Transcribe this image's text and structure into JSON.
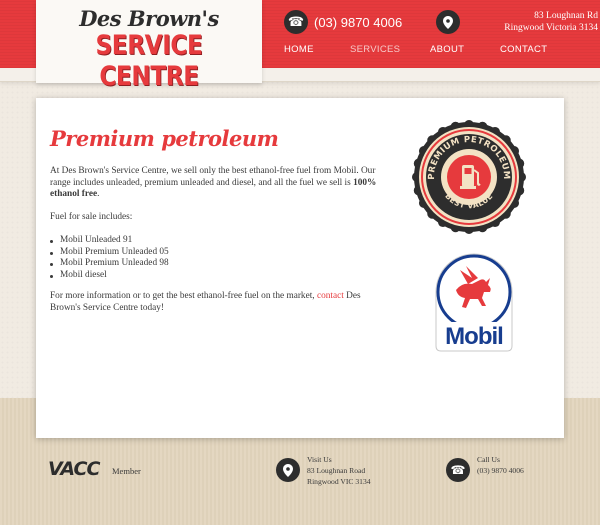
{
  "brand": {
    "script_line": "Des Brown's",
    "main_line": "SERVICE CENTRE"
  },
  "header": {
    "phone": "(03) 9870 4006",
    "address_line1": "83 Loughnan Rd",
    "address_line2": "Ringwood Victoria 3134",
    "phone_icon": "phone-icon",
    "location_icon": "location-pin-icon"
  },
  "nav": {
    "items": [
      {
        "label": "HOME",
        "active": false
      },
      {
        "label": "SERVICES",
        "active": true
      },
      {
        "label": "ABOUT",
        "active": false
      },
      {
        "label": "CONTACT",
        "active": false
      }
    ]
  },
  "main": {
    "title": "Premium petroleum",
    "intro_pre": "At Des Brown's Service Centre, we sell only the best ethanol-free fuel from Mobil. Our range includes unleaded, premium unleaded and diesel, and all the fuel we sell is ",
    "intro_bold": "100% ethanol free",
    "intro_post": ".",
    "list_heading": "Fuel for sale includes:",
    "fuels": [
      "Mobil Unleaded 91",
      "Mobil Premium Unleaded 05",
      "Mobil Premium Unleaded 98",
      "Mobil diesel"
    ],
    "outro_pre": "For more information or to get the best ethanol-free fuel on the market, ",
    "outro_link": "contact",
    "outro_post": " Des Brown's Service Centre today!"
  },
  "badges": {
    "premium_top": "PREMIUM PETROLEUM",
    "premium_bottom": "BEST VALUE",
    "mobil_word": "Mobil"
  },
  "footer": {
    "vacc": "VACC",
    "member": "Member",
    "visit_label": "Visit Us",
    "visit_line1": "83 Loughnan Road",
    "visit_line2": "Ringwood VIC 3134",
    "call_label": "Call Us",
    "call_number": "(03) 9870 4006"
  },
  "colors": {
    "brand_red": "#e63a3d",
    "dark": "#2d2d2d",
    "badge_cream": "#f3e2c4"
  }
}
